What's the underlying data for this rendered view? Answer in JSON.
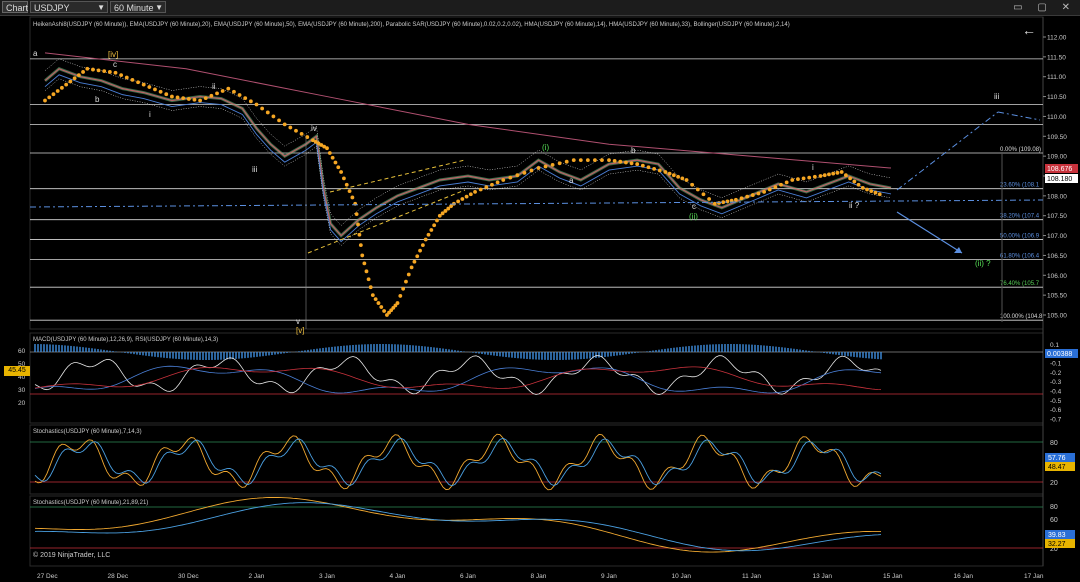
{
  "toolbar": {
    "chart_label": "Chart",
    "symbol": "USDJPY",
    "interval": "60 Minute",
    "window_controls": "▭ ▢ ✕"
  },
  "copyright": "© 2019 NinjaTrader, LLC",
  "rsi_badge": "45.45",
  "colors": {
    "background": "#000000",
    "fib": "#d9d9d9",
    "wave": "#f0c040",
    "dots": "#f5a623",
    "blue": "#4a7fd6",
    "red": "#c8323c",
    "green": "#2e8b57"
  },
  "chart_data": [
    {
      "type": "line",
      "title": "HeikenAshi8(USDJPY (60 Minute)), EMA(USDJPY (60 Minute),20), EMA(USDJPY (60 Minute),50), EMA(USDJPY (60 Minute),200), Parabolic SAR(USDJPY (60 Minute),0.02,0.2,0.02), HMA(USDJPY (60 Minute),14), HMA(USDJPY (60 Minute),33), Bollinger(USDJPY (60 Minute),2,14)",
      "x_labels": [
        "27 Dec",
        "28 Dec",
        "30 Dec",
        "2 Jan",
        "3 Jan",
        "4 Jan",
        "6 Jan",
        "8 Jan",
        "9 Jan",
        "10 Jan",
        "11 Jan",
        "13 Jan",
        "15 Jan",
        "16 Jan",
        "17 Jan"
      ],
      "y_ticks": [
        "112.00",
        "111.50",
        "111.00",
        "110.50",
        "110.00",
        "109.50",
        "109.00",
        "108.50",
        "108.00",
        "107.50",
        "107.00",
        "106.50",
        "106.00",
        "105.50",
        "105.00"
      ],
      "ylim": [
        104.8,
        112.1
      ],
      "price_series": [
        [
          0,
          110.9
        ],
        [
          0.2,
          111.2
        ],
        [
          0.5,
          111.0
        ],
        [
          0.8,
          110.9
        ],
        [
          1.1,
          110.7
        ],
        [
          1.4,
          110.6
        ],
        [
          1.8,
          110.4
        ],
        [
          2.2,
          110.5
        ],
        [
          2.5,
          110.45
        ],
        [
          2.8,
          110.2
        ],
        [
          3.0,
          109.7
        ],
        [
          3.2,
          109.3
        ],
        [
          3.4,
          109.0
        ],
        [
          3.7,
          109.3
        ],
        [
          3.85,
          109.5
        ],
        [
          3.95,
          108.2
        ],
        [
          4.05,
          107.3
        ],
        [
          4.2,
          107.0
        ],
        [
          4.45,
          107.4
        ],
        [
          4.7,
          107.7
        ],
        [
          5.0,
          108.0
        ],
        [
          5.3,
          108.2
        ],
        [
          5.6,
          108.4
        ],
        [
          6.0,
          108.5
        ],
        [
          6.3,
          108.4
        ],
        [
          6.7,
          108.5
        ],
        [
          7.0,
          108.9
        ],
        [
          7.3,
          108.6
        ],
        [
          7.6,
          108.4
        ],
        [
          8.0,
          108.8
        ],
        [
          8.4,
          108.9
        ],
        [
          8.7,
          108.8
        ],
        [
          9.0,
          108.2
        ],
        [
          9.3,
          107.9
        ],
        [
          9.6,
          107.7
        ],
        [
          10.0,
          108.0
        ],
        [
          10.4,
          108.3
        ],
        [
          10.8,
          108.1
        ],
        [
          11.1,
          108.3
        ],
        [
          11.4,
          108.5
        ],
        [
          11.7,
          108.3
        ],
        [
          12.0,
          108.2
        ]
      ],
      "sar_dots": [
        [
          0,
          110.4
        ],
        [
          0.3,
          110.8
        ],
        [
          0.6,
          111.2
        ],
        [
          1.0,
          111.1
        ],
        [
          1.4,
          110.8
        ],
        [
          1.8,
          110.5
        ],
        [
          2.2,
          110.4
        ],
        [
          2.6,
          110.7
        ],
        [
          3.0,
          110.3
        ],
        [
          3.4,
          109.8
        ],
        [
          3.8,
          109.4
        ],
        [
          4.0,
          109.2
        ],
        [
          4.2,
          108.6
        ],
        [
          4.4,
          107.8
        ],
        [
          4.5,
          106.5
        ],
        [
          4.65,
          105.5
        ],
        [
          4.85,
          105.0
        ],
        [
          5.0,
          105.3
        ],
        [
          5.2,
          106.2
        ],
        [
          5.4,
          106.9
        ],
        [
          5.6,
          107.5
        ],
        [
          5.8,
          107.8
        ],
        [
          6.1,
          108.1
        ],
        [
          6.5,
          108.4
        ],
        [
          7.0,
          108.7
        ],
        [
          7.5,
          108.9
        ],
        [
          8.0,
          108.9
        ],
        [
          8.4,
          108.8
        ],
        [
          8.8,
          108.6
        ],
        [
          9.1,
          108.4
        ],
        [
          9.5,
          107.8
        ],
        [
          9.8,
          107.9
        ],
        [
          10.2,
          108.1
        ],
        [
          10.6,
          108.4
        ],
        [
          11.0,
          108.5
        ],
        [
          11.3,
          108.6
        ],
        [
          11.6,
          108.2
        ],
        [
          11.9,
          108.0
        ]
      ],
      "ema200": [
        [
          0,
          111.6
        ],
        [
          2,
          111.2
        ],
        [
          4,
          110.5
        ],
        [
          6,
          109.8
        ],
        [
          8,
          109.3
        ],
        [
          10,
          109.0
        ],
        [
          12,
          108.7
        ]
      ],
      "fib_levels": [
        {
          "value": 111.45,
          "label": ""
        },
        {
          "value": 110.3,
          "label": ""
        },
        {
          "value": 109.8,
          "label": ""
        },
        {
          "value": 109.08,
          "label": "0.00% (109.08)"
        },
        {
          "value": 108.18,
          "label": "23.60% (108.1"
        },
        {
          "value": 107.4,
          "label": "38.20% (107.4"
        },
        {
          "value": 106.9,
          "label": "50.00% (106.9"
        },
        {
          "value": 106.4,
          "label": "61.80% (106.4"
        },
        {
          "value": 105.7,
          "label": "76.40% (105.7"
        },
        {
          "value": 104.87,
          "label": "100.00% (104.8"
        }
      ],
      "price_badges": [
        {
          "value": "108.676",
          "color": "#c8323c"
        },
        {
          "value": "108.180",
          "color": "#ffffff"
        }
      ],
      "wave_labels": [
        "a",
        "[iv]",
        "b",
        "c",
        "i",
        "ii",
        "iii",
        "iv",
        "v",
        "[v]",
        "(i)",
        "a",
        "b",
        "c",
        "(ii)",
        "i",
        "ii ?",
        "iii",
        "(ii) ?"
      ]
    },
    {
      "type": "line",
      "title": "MACD(USDJPY (60 Minute),12,26,9), RSI(USDJPY (60 Minute),14,3)",
      "y_ticks_left": [
        "60",
        "50",
        "40",
        "30",
        "20"
      ],
      "y_ticks_right": [
        "0.1",
        "0",
        "-0.1",
        "-0.2",
        "-0.3",
        "-0.4",
        "-0.5",
        "-0.6",
        "-0.7"
      ],
      "value_badge": "0.00388"
    },
    {
      "type": "line",
      "title": "Stochastics(USDJPY (60 Minute),7,14,3)",
      "y_ticks": [
        "80",
        "20"
      ],
      "value_badges": [
        "57.76",
        "48.47"
      ],
      "ylim": [
        0,
        100
      ]
    },
    {
      "type": "line",
      "title": "Stochastics(USDJPY (60 Minute),21,89,21)",
      "y_ticks": [
        "80",
        "60",
        "40",
        "20"
      ],
      "value_badges": [
        "39.83",
        "32.27"
      ],
      "ylim": [
        0,
        100
      ]
    }
  ]
}
